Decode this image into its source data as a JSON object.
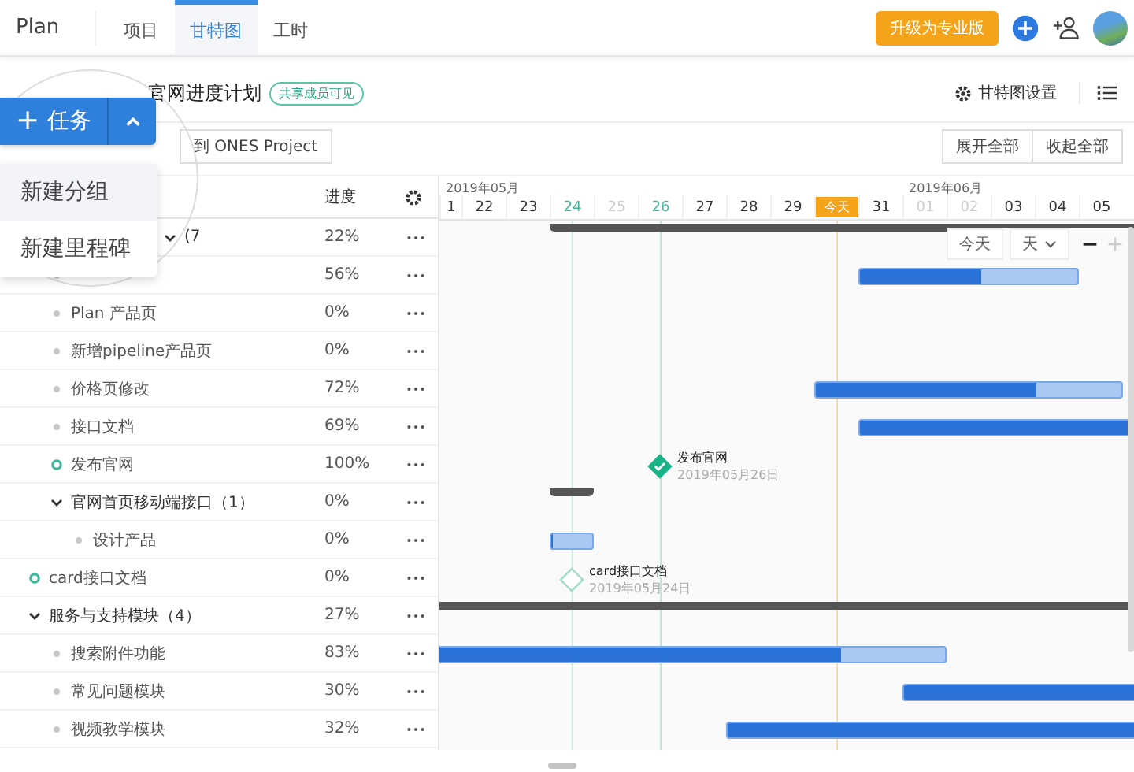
{
  "nav": {
    "logo": "Plan",
    "tabs": [
      {
        "label": "项目",
        "selected": false
      },
      {
        "label": "甘特图",
        "selected": true
      },
      {
        "label": "工时",
        "selected": false
      }
    ],
    "upgrade": "升级为专业版"
  },
  "plan": {
    "title": "官网进度计划",
    "tag": "共享成员可见",
    "settings": "甘特图设置"
  },
  "toolbar": {
    "import": "到 ONES Project",
    "expand_all": "展开全部",
    "collapse_all": "收起全部"
  },
  "add_task": {
    "icon": "+",
    "label": "任务",
    "menu_open": true,
    "menu": [
      {
        "label": "新建分组",
        "selected": true
      },
      {
        "label": "新建里程碑",
        "selected": false
      }
    ]
  },
  "table": {
    "columns": [
      "进度"
    ]
  },
  "rows": [
    {
      "kind": "group",
      "name": "(7",
      "progress": "22%",
      "expanded": true,
      "children": [
        {
          "kind": "task",
          "progress": "56%",
          "bar": {
            "level": 0.56
          }
        },
        {
          "kind": "task",
          "name": "Plan 产品页",
          "progress": "0%"
        },
        {
          "kind": "task",
          "name": "新增pipeline产品页",
          "progress": "0%"
        },
        {
          "kind": "task",
          "name": "价格页修改",
          "progress": "72%",
          "bar": {
            "level": 0.72
          }
        },
        {
          "kind": "task",
          "name": "接口文档",
          "progress": "69%",
          "bar": {
            "level": 0.69
          }
        },
        {
          "kind": "milestone",
          "name": "发布官网",
          "progress": "100%",
          "done": true,
          "label": "发布官网",
          "date": "2019年05月26日"
        },
        {
          "kind": "group",
          "name": "官网首页移动端接口（1）",
          "progress": "0%",
          "expanded": true,
          "children": [
            {
              "kind": "task",
              "name": "设计产品",
              "progress": "0%",
              "bar": {
                "level": 0
              }
            }
          ]
        }
      ]
    },
    {
      "kind": "milestone",
      "name": "card接口文档",
      "progress": "0%",
      "done": false,
      "label": "card接口文档",
      "date": "2019年05月24日"
    },
    {
      "kind": "group",
      "name": "服务与支持模块（4）",
      "progress": "27%",
      "expanded": true,
      "children": [
        {
          "kind": "task",
          "name": "搜索附件功能",
          "progress": "83%",
          "bar": {
            "level": 0.83
          }
        },
        {
          "kind": "task",
          "name": "常见问题模块",
          "progress": "30%",
          "bar": {
            "level": 0.3
          }
        },
        {
          "kind": "task",
          "name": "视频教学模块",
          "progress": "32%",
          "bar": {
            "level": 0.32
          }
        }
      ]
    }
  ],
  "timeline": {
    "days": [
      {
        "label": "1",
        "kind": "normal",
        "month": "2019年05月"
      },
      {
        "label": "22",
        "kind": "normal"
      },
      {
        "label": "23",
        "kind": "normal"
      },
      {
        "label": "24",
        "kind": "milestone"
      },
      {
        "label": "25",
        "kind": "weekend"
      },
      {
        "label": "26",
        "kind": "milestone"
      },
      {
        "label": "27",
        "kind": "normal"
      },
      {
        "label": "28",
        "kind": "normal"
      },
      {
        "label": "29",
        "kind": "normal"
      },
      {
        "label": "今天",
        "kind": "today"
      },
      {
        "label": "31",
        "kind": "normal"
      },
      {
        "label": "01",
        "kind": "weekend",
        "month": "2019年06月"
      },
      {
        "label": "02",
        "kind": "weekend"
      },
      {
        "label": "03",
        "kind": "normal"
      },
      {
        "label": "04",
        "kind": "normal"
      },
      {
        "label": "05",
        "kind": "normal"
      }
    ],
    "zoom": {
      "today": "今天",
      "unit": "天",
      "buttons": [
        {
          "kind": "minus",
          "disabled": false
        },
        {
          "kind": "plus",
          "disabled": true
        }
      ]
    }
  }
}
